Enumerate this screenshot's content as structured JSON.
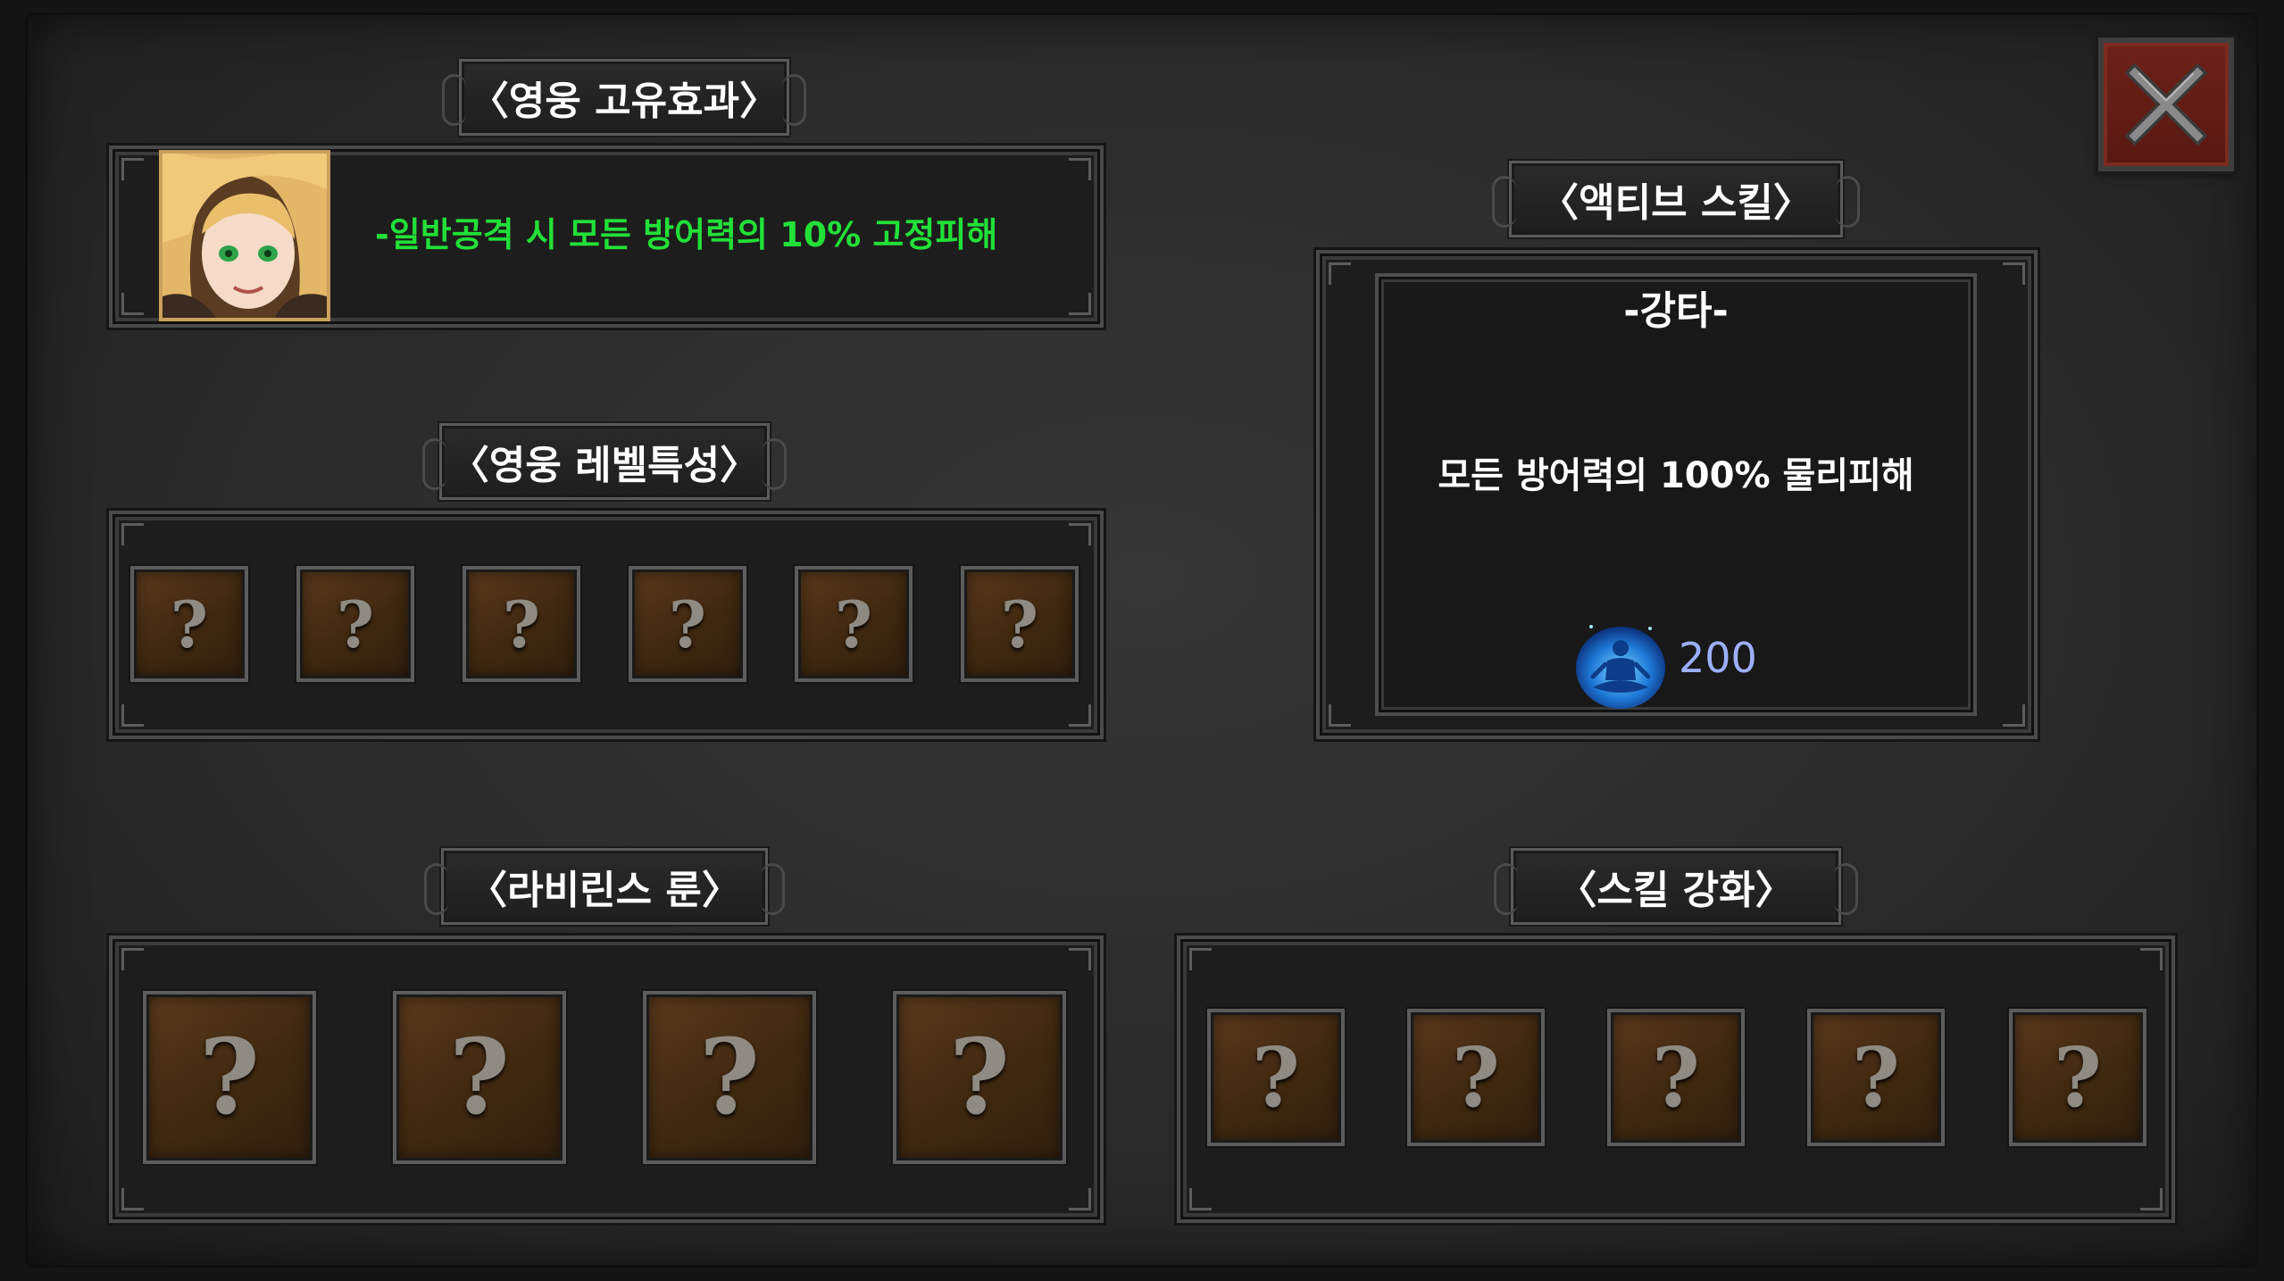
{
  "close_button": {
    "icon": "close-icon"
  },
  "hero_unique": {
    "title": "〈영웅 고유효과〉",
    "effect": "-일반공격 시 모든 방어력의 10% 고정피해",
    "effect_color": "#22e038"
  },
  "hero_level": {
    "title": "〈영웅 레벨특성〉",
    "slots": [
      "?",
      "?",
      "?",
      "?",
      "?",
      "?"
    ]
  },
  "active_skill": {
    "title": "〈액티브 스킬〉",
    "name": "-강타-",
    "description": "모든 방어력의 100% 물리피해",
    "cost_icon": "meditation-mana-icon",
    "cost": "200",
    "cost_color": "#9bb0ff"
  },
  "labyrinth_rune": {
    "title": "〈라비린스 룬〉",
    "slots": [
      "?",
      "?",
      "?",
      "?"
    ]
  },
  "skill_enhance": {
    "title": "〈스킬 강화〉",
    "slots": [
      "?",
      "?",
      "?",
      "?",
      "?"
    ]
  }
}
